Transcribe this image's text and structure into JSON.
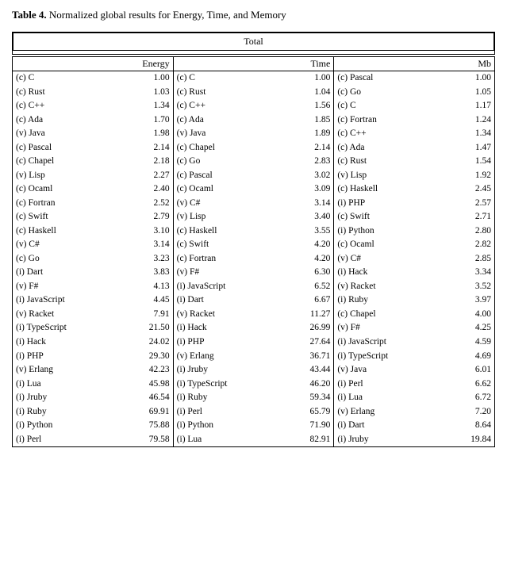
{
  "title": {
    "prefix": "Table 4.",
    "suffix": " Normalized global results for Energy, Time, and Memory"
  },
  "total_label": "Total",
  "energy": {
    "header": "Energy",
    "rows": [
      [
        "(c) C",
        "1.00"
      ],
      [
        "(c) Rust",
        "1.03"
      ],
      [
        "(c) C++",
        "1.34"
      ],
      [
        "(c) Ada",
        "1.70"
      ],
      [
        "(v) Java",
        "1.98"
      ],
      [
        "(c) Pascal",
        "2.14"
      ],
      [
        "(c) Chapel",
        "2.18"
      ],
      [
        "(v) Lisp",
        "2.27"
      ],
      [
        "(c) Ocaml",
        "2.40"
      ],
      [
        "(c) Fortran",
        "2.52"
      ],
      [
        "(c) Swift",
        "2.79"
      ],
      [
        "(c) Haskell",
        "3.10"
      ],
      [
        "(v) C#",
        "3.14"
      ],
      [
        "(c) Go",
        "3.23"
      ],
      [
        "(i) Dart",
        "3.83"
      ],
      [
        "(v) F#",
        "4.13"
      ],
      [
        "(i) JavaScript",
        "4.45"
      ],
      [
        "(v) Racket",
        "7.91"
      ],
      [
        "(i) TypeScript",
        "21.50"
      ],
      [
        "(i) Hack",
        "24.02"
      ],
      [
        "(i) PHP",
        "29.30"
      ],
      [
        "(v) Erlang",
        "42.23"
      ],
      [
        "(i) Lua",
        "45.98"
      ],
      [
        "(i) Jruby",
        "46.54"
      ],
      [
        "(i) Ruby",
        "69.91"
      ],
      [
        "(i) Python",
        "75.88"
      ],
      [
        "(i) Perl",
        "79.58"
      ]
    ]
  },
  "time": {
    "header": "Time",
    "rows": [
      [
        "(c) C",
        "1.00"
      ],
      [
        "(c) Rust",
        "1.04"
      ],
      [
        "(c) C++",
        "1.56"
      ],
      [
        "(c) Ada",
        "1.85"
      ],
      [
        "(v) Java",
        "1.89"
      ],
      [
        "(c) Chapel",
        "2.14"
      ],
      [
        "(c) Go",
        "2.83"
      ],
      [
        "(c) Pascal",
        "3.02"
      ],
      [
        "(c) Ocaml",
        "3.09"
      ],
      [
        "(v) C#",
        "3.14"
      ],
      [
        "(v) Lisp",
        "3.40"
      ],
      [
        "(c) Haskell",
        "3.55"
      ],
      [
        "(c) Swift",
        "4.20"
      ],
      [
        "(c) Fortran",
        "4.20"
      ],
      [
        "(v) F#",
        "6.30"
      ],
      [
        "(i) JavaScript",
        "6.52"
      ],
      [
        "(i) Dart",
        "6.67"
      ],
      [
        "(v) Racket",
        "11.27"
      ],
      [
        "(i) Hack",
        "26.99"
      ],
      [
        "(i) PHP",
        "27.64"
      ],
      [
        "(v) Erlang",
        "36.71"
      ],
      [
        "(i) Jruby",
        "43.44"
      ],
      [
        "(i) TypeScript",
        "46.20"
      ],
      [
        "(i) Ruby",
        "59.34"
      ],
      [
        "(i) Perl",
        "65.79"
      ],
      [
        "(i) Python",
        "71.90"
      ],
      [
        "(i) Lua",
        "82.91"
      ]
    ]
  },
  "memory": {
    "header": "Mb",
    "rows": [
      [
        "(c) Pascal",
        "1.00"
      ],
      [
        "(c) Go",
        "1.05"
      ],
      [
        "(c) C",
        "1.17"
      ],
      [
        "(c) Fortran",
        "1.24"
      ],
      [
        "(c) C++",
        "1.34"
      ],
      [
        "(c) Ada",
        "1.47"
      ],
      [
        "(c) Rust",
        "1.54"
      ],
      [
        "(v) Lisp",
        "1.92"
      ],
      [
        "(c) Haskell",
        "2.45"
      ],
      [
        "(i) PHP",
        "2.57"
      ],
      [
        "(c) Swift",
        "2.71"
      ],
      [
        "(i) Python",
        "2.80"
      ],
      [
        "(c) Ocaml",
        "2.82"
      ],
      [
        "(v) C#",
        "2.85"
      ],
      [
        "(i) Hack",
        "3.34"
      ],
      [
        "(v) Racket",
        "3.52"
      ],
      [
        "(i) Ruby",
        "3.97"
      ],
      [
        "(c) Chapel",
        "4.00"
      ],
      [
        "(v) F#",
        "4.25"
      ],
      [
        "(i) JavaScript",
        "4.59"
      ],
      [
        "(i) TypeScript",
        "4.69"
      ],
      [
        "(v) Java",
        "6.01"
      ],
      [
        "(i) Perl",
        "6.62"
      ],
      [
        "(i) Lua",
        "6.72"
      ],
      [
        "(v) Erlang",
        "7.20"
      ],
      [
        "(i) Dart",
        "8.64"
      ],
      [
        "(i) Jruby",
        "19.84"
      ]
    ]
  }
}
